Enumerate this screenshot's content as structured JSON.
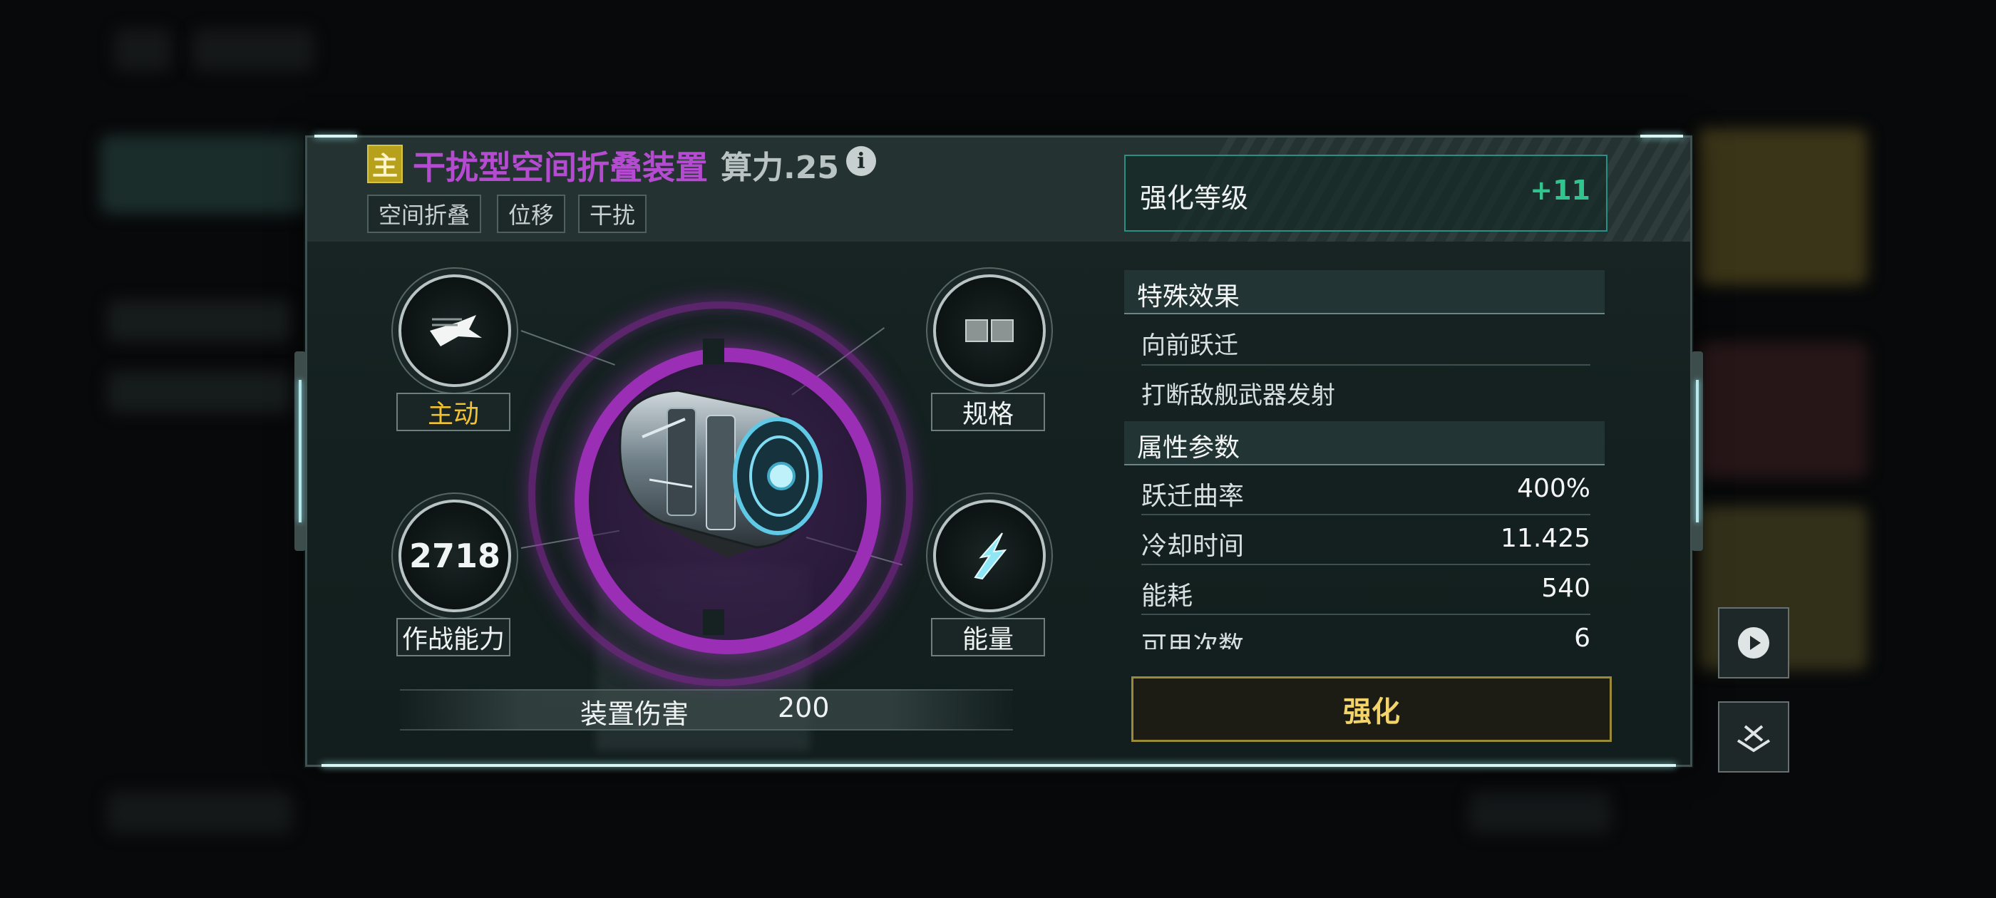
{
  "item": {
    "badge": "主",
    "name": "干扰型空间折叠装置",
    "power": "算力.25",
    "info_icon": "info-icon",
    "tags": [
      "空间折叠",
      "位移",
      "干扰"
    ]
  },
  "stats": {
    "active_label": "主动",
    "spec_label": "规格",
    "combat_value": "2718",
    "combat_label": "作战能力",
    "energy_label": "能量",
    "damage_label": "装置伤害",
    "damage_value": "200"
  },
  "enhance": {
    "level_label": "强化等级",
    "level_value": "+11",
    "button_label": "强化"
  },
  "effects": {
    "header": "特殊效果",
    "items": [
      "向前跃迁",
      "打断敌舰武器发射"
    ]
  },
  "attributes": {
    "header": "属性参数",
    "rows": [
      {
        "label": "跃迁曲率",
        "value": "400%"
      },
      {
        "label": "冷却时间",
        "value": "11.425"
      },
      {
        "label": "能耗",
        "value": "540"
      },
      {
        "label": "可用次数",
        "value": "6"
      }
    ]
  },
  "colors": {
    "title_purple": "#b44bd0",
    "level_green": "#32c48f",
    "active_yellow": "#f1c232",
    "button_gold": "#f2d46a"
  }
}
